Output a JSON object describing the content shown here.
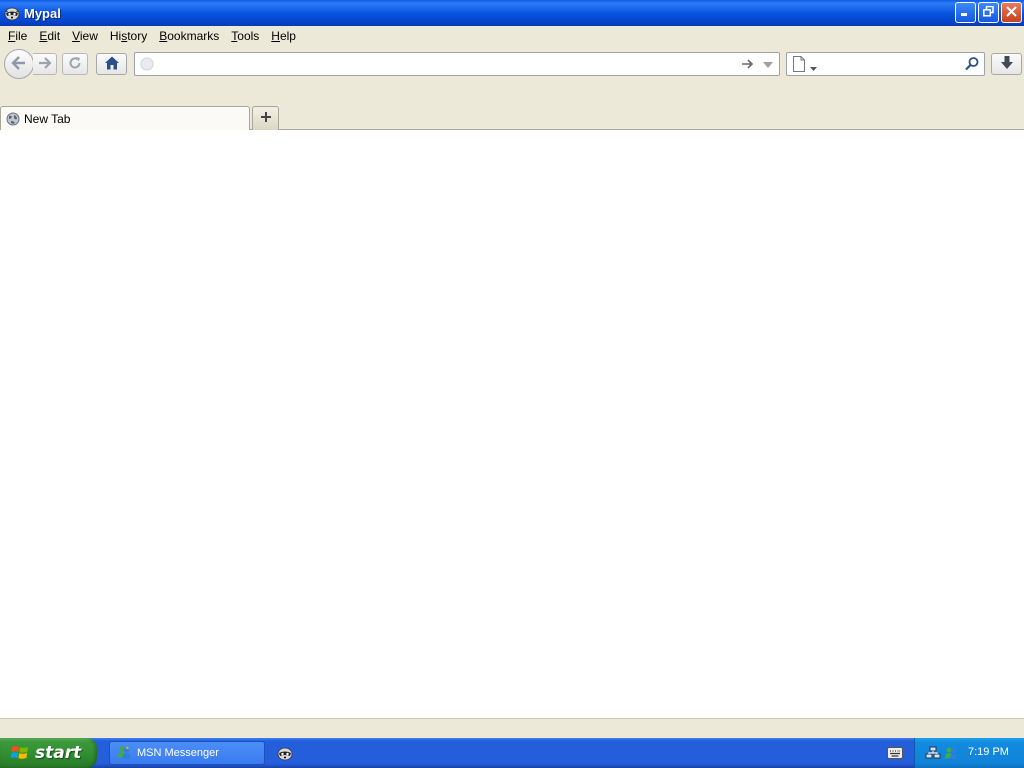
{
  "window": {
    "title": "Mypal",
    "app_icon": "mypal-raccoon-icon",
    "controls": [
      "minimize-icon",
      "restore-icon",
      "close-icon"
    ]
  },
  "menubar": {
    "items": [
      {
        "label": "File",
        "accel": "F"
      },
      {
        "label": "Edit",
        "accel": "E"
      },
      {
        "label": "View",
        "accel": "V"
      },
      {
        "label": "History",
        "accel": "H"
      },
      {
        "label": "Bookmarks",
        "accel": "B"
      },
      {
        "label": "Tools",
        "accel": "T"
      },
      {
        "label": "Help",
        "accel": "H"
      }
    ]
  },
  "navbar": {
    "icons": [
      "back-arrow-icon",
      "forward-arrow-icon",
      "reload-icon",
      "home-icon"
    ],
    "url": {
      "value": "",
      "placeholder": ""
    },
    "search": {
      "value": "",
      "placeholder": ""
    },
    "download_icon": "download-arrow-icon"
  },
  "tabs": [
    {
      "label": "New Tab",
      "icon": "globe-icon",
      "active": true
    }
  ],
  "newtab_icon": "plus-icon",
  "taskbar": {
    "start_label": "start",
    "task_buttons": [
      {
        "label": "MSN Messenger",
        "icon": "msn-messenger-icon"
      }
    ],
    "quick_launch_icon": "mypal-raccoon-icon",
    "tray": {
      "icons": [
        "network-icon",
        "msn-tray-icon",
        "keyboard-icon"
      ],
      "clock": "7:19 PM"
    }
  },
  "colors": {
    "titlebar": "#0955e0",
    "chrome": "#ece9d8",
    "taskbar": "#245edb",
    "start": "#2f8c2f",
    "tray": "#0f83d8"
  }
}
